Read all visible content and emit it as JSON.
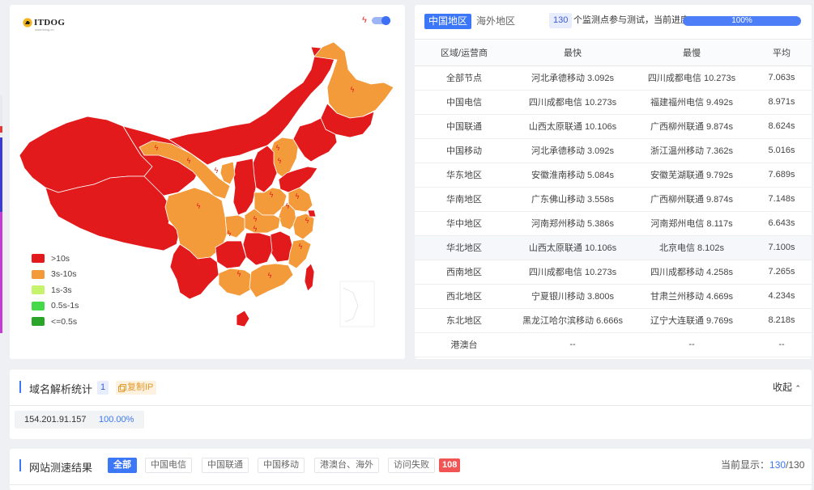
{
  "logo": {
    "text": "ITDOG",
    "sub": "www.itdog.cn"
  },
  "map": {
    "colors": {
      "very_slow": "#e31a1c",
      "slow": "#f39a3b",
      "medium": "#c5f46c",
      "fast": "#45d94a",
      "very_fast": "#2aa52a"
    },
    "legend": [
      {
        "label": ">10s",
        "color": "#e31a1c"
      },
      {
        "label": "3s-10s",
        "color": "#f39a3b"
      },
      {
        "label": "1s-3s",
        "color": "#c5f46c"
      },
      {
        "label": "0.5s-1s",
        "color": "#45d94a"
      },
      {
        "label": "<=0.5s",
        "color": "#2aa52a"
      }
    ]
  },
  "stats": {
    "tab_active": "中国地区",
    "tab_inactive": "海外地区",
    "node_count": "130",
    "progress_label": "个监测点参与测试，当前进度:",
    "progress_value": 100,
    "progress_text": "100%",
    "columns": [
      "区域/运营商",
      "最快",
      "最慢",
      "平均"
    ],
    "rows": [
      [
        "全部节点",
        "河北承德移动 3.092s",
        "四川成都电信 10.273s",
        "7.063s"
      ],
      [
        "中国电信",
        "四川成都电信 10.273s",
        "福建福州电信 9.492s",
        "8.971s"
      ],
      [
        "中国联通",
        "山西太原联通 10.106s",
        "广西柳州联通 9.874s",
        "8.624s"
      ],
      [
        "中国移动",
        "河北承德移动 3.092s",
        "浙江温州移动 7.362s",
        "5.016s"
      ],
      [
        "华东地区",
        "安徽淮南移动 5.084s",
        "安徽芜湖联通 9.792s",
        "7.689s"
      ],
      [
        "华南地区",
        "广东佛山移动 3.558s",
        "广西柳州联通 9.874s",
        "7.148s"
      ],
      [
        "华中地区",
        "河南郑州移动 5.386s",
        "河南郑州电信 8.117s",
        "6.643s"
      ],
      [
        "华北地区",
        "山西太原联通 10.106s",
        "北京电信 8.102s",
        "7.100s"
      ],
      [
        "西南地区",
        "四川成都电信 10.273s",
        "四川成都移动 4.258s",
        "7.265s"
      ],
      [
        "西北地区",
        "宁夏银川移动 3.800s",
        "甘肃兰州移动 4.669s",
        "4.234s"
      ],
      [
        "东北地区",
        "黑龙江哈尔滨移动 6.666s",
        "辽宁大连联通 9.769s",
        "8.218s"
      ],
      [
        "港澳台",
        "--",
        "--",
        "--"
      ]
    ]
  },
  "dns": {
    "title": "域名解析统计",
    "count": "1",
    "copy_label": "复制IP",
    "collapse_label": "收起",
    "entries": [
      {
        "ip": "154.201.91.157",
        "percent": "100.00%"
      }
    ]
  },
  "results": {
    "title": "网站测速结果",
    "filters": [
      "全部",
      "中国电信",
      "中国联通",
      "中国移动",
      "港澳台、海外",
      "访问失败"
    ],
    "fail_count": "108",
    "display_prefix": "当前显示：",
    "display_current": "130",
    "display_total": "/130"
  }
}
